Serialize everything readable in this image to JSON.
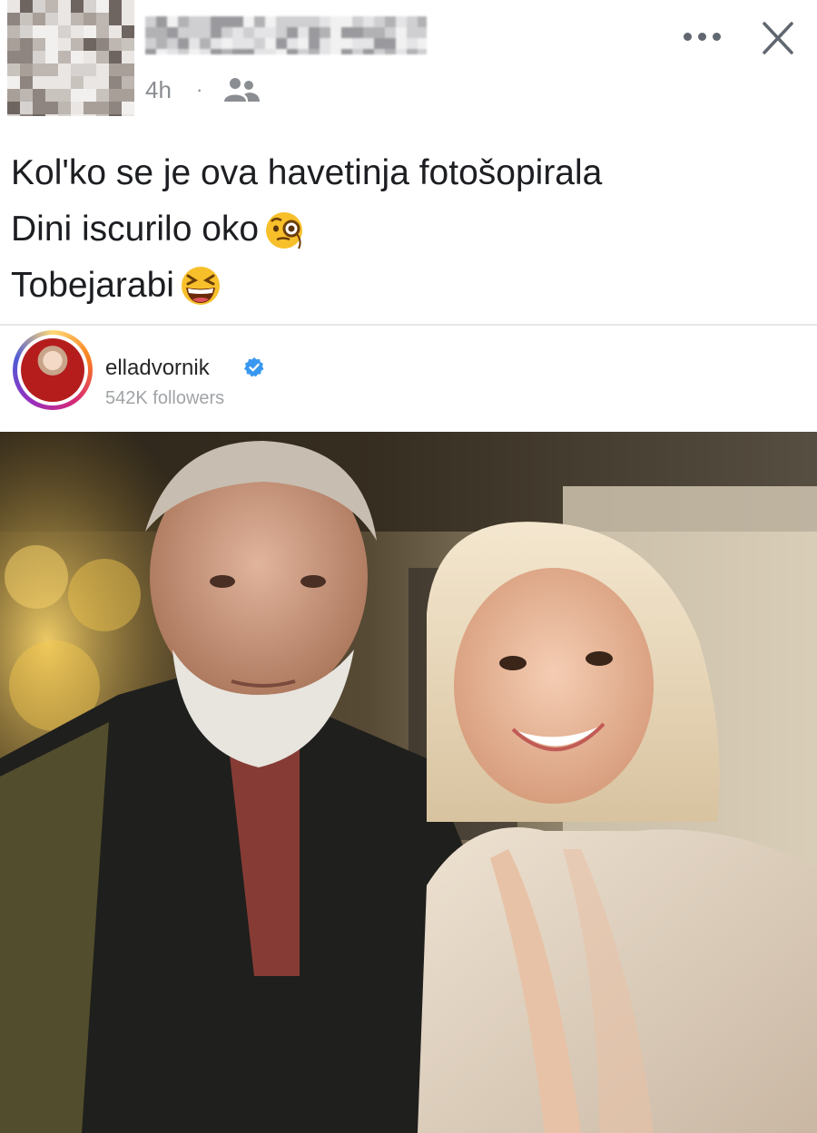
{
  "post": {
    "timestamp": "4h",
    "separator": "·",
    "audience_icon": "friends-icon",
    "more_icon": "more-icon",
    "close_icon": "close-icon",
    "text_lines": [
      {
        "text": "Kol'ko se je ova havetinja fotošopirala",
        "emoji": ""
      },
      {
        "text": "Dini iscurilo oko",
        "emoji": "face-with-monocle"
      },
      {
        "text": "Tobejarabi ",
        "emoji": "grinning-squinting-face"
      }
    ]
  },
  "embed": {
    "username": "elladvornik",
    "verified_icon": "verified-badge-icon",
    "followers": "542K followers"
  },
  "colors": {
    "text": "#1c1e21",
    "meta": "#8a8d91",
    "verified": "#3897f0",
    "divider": "#e6e6e6"
  }
}
